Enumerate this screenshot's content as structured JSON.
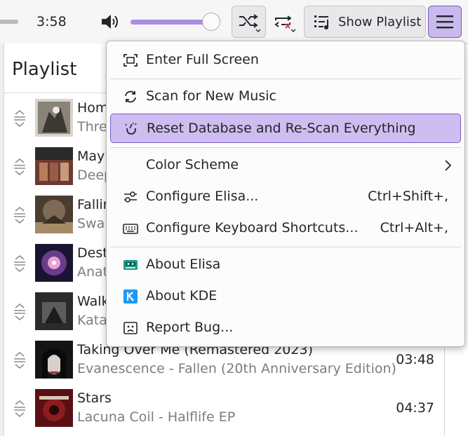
{
  "player": {
    "time": "3:58",
    "volume_percent": 100,
    "show_playlist_label": "Show Playlist"
  },
  "playlist": {
    "title": "Playlist",
    "rows": [
      {
        "title": "Hom",
        "artist": "Thre",
        "duration": ""
      },
      {
        "title": "Mayl",
        "artist": "Deep",
        "duration": ""
      },
      {
        "title": "Fallir",
        "artist": "Swal",
        "duration": ""
      },
      {
        "title": "Dest",
        "artist": "Anat",
        "duration": ""
      },
      {
        "title": "Walk",
        "artist": "Kata",
        "duration": ""
      },
      {
        "title": "Taking Over Me (Remastered 2023)",
        "artist": "Evanescence - Fallen (20th Anniversary Edition)",
        "duration": "03:48"
      },
      {
        "title": "Stars",
        "artist": "Lacuna Coil - Halflife EP",
        "duration": "04:37"
      }
    ]
  },
  "menu": {
    "items": [
      {
        "label": "Enter Full Screen",
        "shortcut": "",
        "icon": "fullscreen-icon"
      },
      {
        "label": "Scan for New Music",
        "shortcut": "",
        "icon": "refresh-icon"
      },
      {
        "label": "Reset Database and Re-Scan Everything",
        "shortcut": "",
        "icon": "clean-icon"
      },
      {
        "label": "Color Scheme",
        "shortcut": "",
        "icon": ""
      },
      {
        "label": "Configure Elisa...",
        "shortcut": "Ctrl+Shift+,",
        "icon": "sliders-icon"
      },
      {
        "label": "Configure Keyboard Shortcuts...",
        "shortcut": "Ctrl+Alt+,",
        "icon": "keyboard-icon"
      },
      {
        "label": "About Elisa",
        "shortcut": "",
        "icon": "elisa-icon"
      },
      {
        "label": "About KDE",
        "shortcut": "",
        "icon": "kde-icon"
      },
      {
        "label": "Report Bug...",
        "shortcut": "",
        "icon": "bug-icon"
      }
    ]
  },
  "colors": {
    "accent": "#7a5dc7",
    "highlight": "#cdbdf0",
    "volume_fill": "#a98de0"
  }
}
